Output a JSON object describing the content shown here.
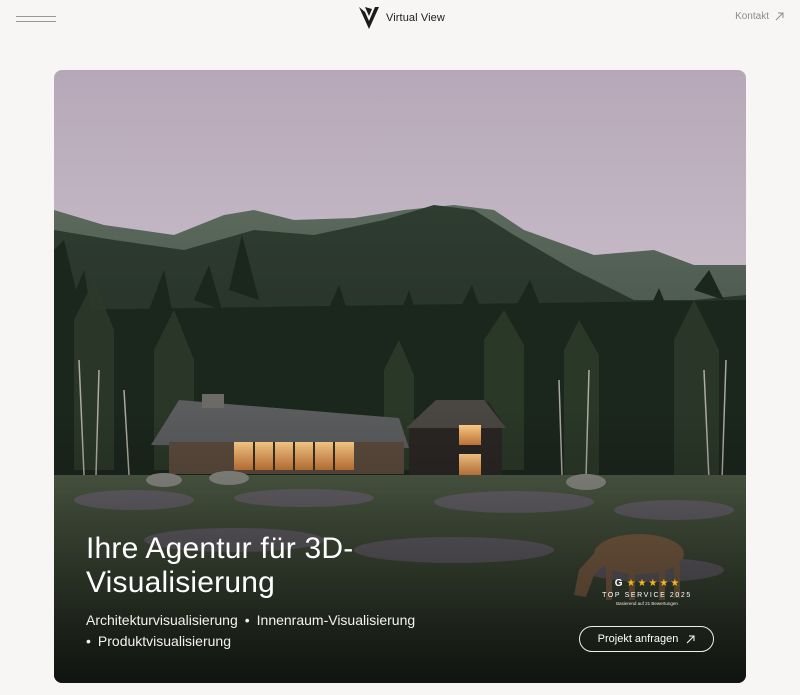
{
  "header": {
    "menu_icon": "hamburger-icon",
    "logo_text": "Virtual View",
    "contact_label": "Kontakt",
    "contact_icon": "arrow-up-right-icon"
  },
  "hero": {
    "title_line1": "Ihre Agentur für 3D-",
    "title_line2": "Visualisierung",
    "services": [
      "Architekturvisualisierung",
      "Innenraum-Visualisierung",
      "Produktvisualisierung"
    ],
    "separator": "•",
    "badge": {
      "google_letter": "G",
      "stars": 5,
      "star_char": "★",
      "title": "TOP SERVICE 2025",
      "subtitle": "Basierend auf 21 Bewertungen"
    },
    "cta_label": "Projekt anfragen",
    "cta_icon": "arrow-up-right-icon"
  },
  "colors": {
    "page_bg": "#f7f6f4",
    "accent_star": "#f2b61c",
    "sky_top": "#b6a8b8",
    "sky_bottom": "#e6dbe3"
  }
}
